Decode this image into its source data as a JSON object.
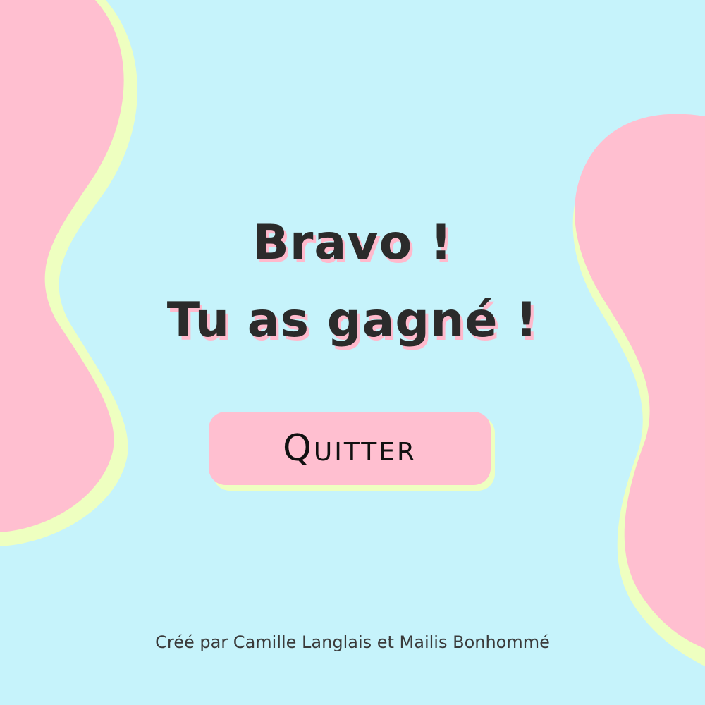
{
  "screen": {
    "title_line_1": "Bravo !",
    "title_line_2": "Tu as gagné !",
    "quit_label": "Quitter",
    "credits": "Créé par Camille Langlais et Mailis Bonhommé"
  },
  "colors": {
    "background": "#c6f3fb",
    "blob_pink": "#ffbfd0",
    "blob_lime": "#eeffc0",
    "title_text": "#2b2b2b",
    "title_shadow": "#ffb9cc"
  }
}
